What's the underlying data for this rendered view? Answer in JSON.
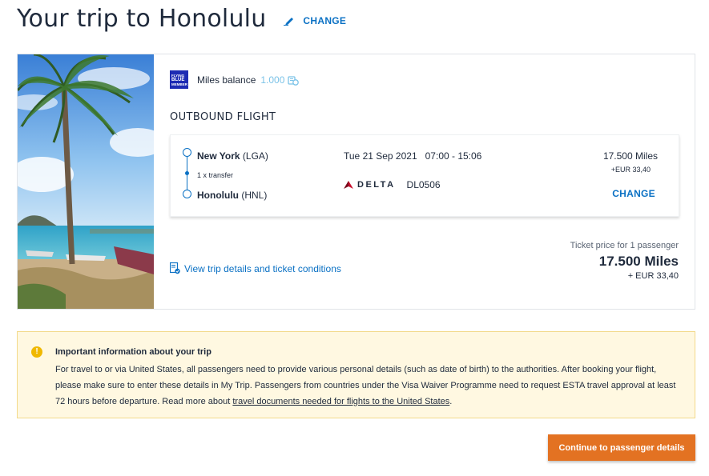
{
  "header": {
    "title": "Your trip to Honolulu",
    "change_label": "CHANGE"
  },
  "miles": {
    "logo_text_1": "FLYING",
    "logo_text_2": "BLUE",
    "logo_text_3": "MEMBER",
    "label": "Miles balance",
    "value": "1.000"
  },
  "outbound": {
    "heading": "OUTBOUND FLIGHT",
    "from_city": "New York",
    "from_code": "(LGA)",
    "transfer": "1 x transfer",
    "to_city": "Honolulu",
    "to_code": "(HNL)",
    "datetime": "Tue 21 Sep 2021   07:00 - 15:06",
    "airline": "DELTA",
    "flight_number": "DL0506",
    "price_miles": "17.500 Miles",
    "price_eur": "+EUR 33,40",
    "change_label": "CHANGE"
  },
  "details_link": "View trip details and ticket conditions",
  "ticket": {
    "label": "Ticket price for 1 passenger",
    "miles": "17.500 Miles",
    "eur": "+ EUR 33,40"
  },
  "info": {
    "icon": "!",
    "title": "Important information about your trip",
    "body": "For travel to or via United States, all passengers need to provide various personal details (such as date of birth) to the authorities. After booking your flight, please make sure to enter these details in My Trip. Passengers from countries under the Visa Waiver Programme need to request ESTA travel approval at least 72 hours before departure. Read more about ",
    "link": "travel documents needed for flights to the United States",
    "end": "."
  },
  "continue_label": "Continue to passenger details",
  "colors": {
    "accent": "#0b71c4",
    "cta": "#e37222",
    "info_bg": "#fff8e1",
    "warning": "#f0b800",
    "flying_blue": "#1d2bb3"
  }
}
